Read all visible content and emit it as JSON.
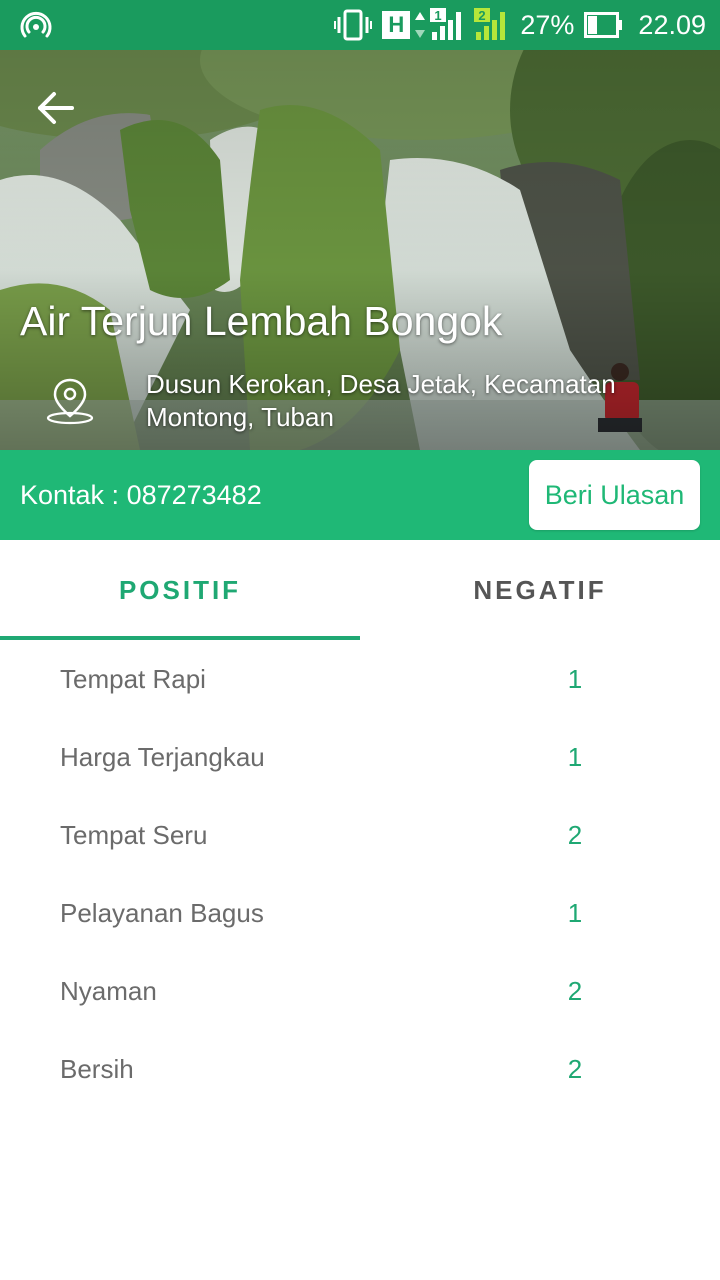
{
  "status_bar": {
    "battery_percent": "27%",
    "time": "22.09",
    "network_label": "H",
    "sim1": "1",
    "sim2": "2",
    "color": "#1a9b5e"
  },
  "header": {
    "title": "Air Terjun Lembah Bongok",
    "address": "Dusun Kerokan, Desa Jetak, Kecamatan Montong, Tuban",
    "back_icon": "arrow-left-icon",
    "location_icon": "location-pin-icon"
  },
  "contact": {
    "label": "Kontak : 087273482",
    "review_button": "Beri Ulasan",
    "color": "#1fb876"
  },
  "tabs": [
    {
      "label": "POSITIF",
      "active": true
    },
    {
      "label": "NEGATIF",
      "active": false
    }
  ],
  "positive_items": [
    {
      "label": "Tempat Rapi",
      "count": "1"
    },
    {
      "label": "Harga Terjangkau",
      "count": "1"
    },
    {
      "label": "Tempat Seru",
      "count": "2"
    },
    {
      "label": "Pelayanan Bagus",
      "count": "1"
    },
    {
      "label": "Nyaman",
      "count": "2"
    },
    {
      "label": "Bersih",
      "count": "2"
    }
  ],
  "accent_color": "#1fa873"
}
